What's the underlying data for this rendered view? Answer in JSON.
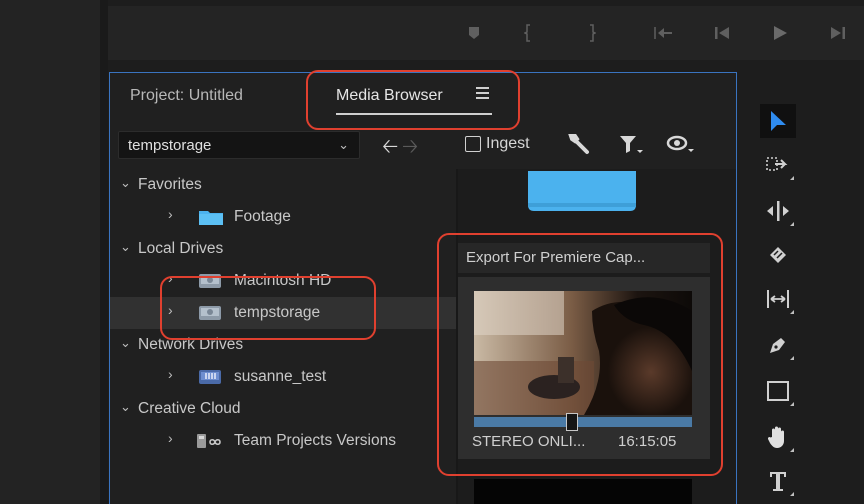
{
  "tabs": {
    "project": "Project: Untitled",
    "media_browser": "Media Browser"
  },
  "toolbar": {
    "location": "tempstorage",
    "ingest_label": "Ingest"
  },
  "tree": {
    "favorites": {
      "label": "Favorites",
      "items": [
        "Footage"
      ]
    },
    "local_drives": {
      "label": "Local Drives",
      "items": [
        "Macintosh HD",
        "tempstorage"
      ]
    },
    "network_drives": {
      "label": "Network Drives",
      "items": [
        "susanne_test"
      ]
    },
    "creative_cloud": {
      "label": "Creative Cloud",
      "items": [
        "Team Projects Versions"
      ]
    }
  },
  "browser": {
    "folder_title": "Export For Premiere Cap...",
    "clip_name": "STEREO ONLI...",
    "clip_duration": "16:15:05"
  },
  "colors": {
    "panel_border": "#3a74c0",
    "highlight": "#e0402f",
    "folder_blue": "#4bb2ee",
    "selection_tool": "#2f8cf0"
  },
  "icons": [
    "play-icon",
    "marker-icon",
    "wrench-icon",
    "filter-icon",
    "eye-icon",
    "folder-icon",
    "drive-icon",
    "network-drive-icon",
    "creative-cloud-icon",
    "hand-icon",
    "pen-icon",
    "type-tool-icon"
  ]
}
